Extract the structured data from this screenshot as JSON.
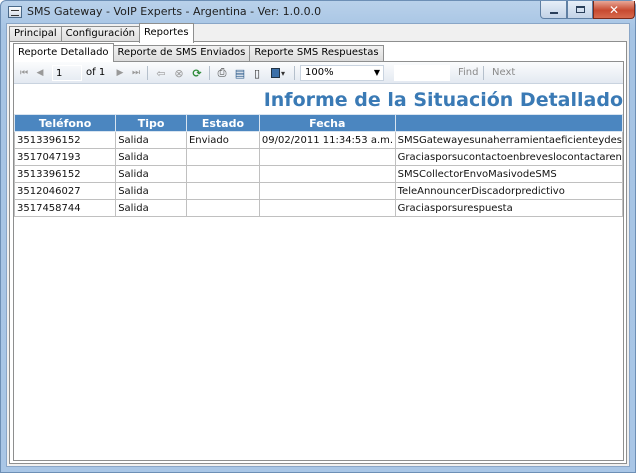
{
  "window": {
    "title": "SMS Gateway - VoIP Experts - Argentina - Ver:  1.0.0.0",
    "close_glyph": "✕"
  },
  "main_tabs": [
    {
      "label": "Principal"
    },
    {
      "label": "Configuración"
    },
    {
      "label": "Reportes"
    }
  ],
  "report_tabs": [
    {
      "label": "Reporte Detallado"
    },
    {
      "label": "Reporte de SMS Enviados"
    },
    {
      "label": "Reporte SMS Respuestas"
    }
  ],
  "toolbar": {
    "first_glyph": "⏮",
    "prev_glyph": "◀",
    "page_value": "1",
    "of_label": "of 1",
    "next_glyph": "▶",
    "last_glyph": "⏭",
    "back_glyph": "⇦",
    "stop_glyph": "⊗",
    "refresh_glyph": "⟳",
    "print_glyph": "⎙",
    "layout_glyph": "▤",
    "pagesetup_glyph": "▯",
    "export_glyph": "▾",
    "zoom_value": "100%",
    "zoom_arrow": "▼",
    "find_label": "Find",
    "next_label": "Next"
  },
  "report": {
    "title": "Informe de la Situación Detallado",
    "columns": [
      "Teléfono",
      "Tipo",
      "Estado",
      "Fecha",
      ""
    ],
    "rows": [
      [
        "3513396152",
        "Salida",
        "Enviado",
        "09/02/2011 11:34:53 a.m.",
        "SMSGatewayesunaherramientaeficienteydes"
      ],
      [
        "3517047193",
        "Salida",
        "",
        "",
        "Graciasporsucontactoenbreveslocontactaren"
      ],
      [
        "3513396152",
        "Salida",
        "",
        "",
        "SMSCollectorEnvoMasivodeSMS"
      ],
      [
        "3512046027",
        "Salida",
        "",
        "",
        "TeleAnnouncerDiscadorpredictivo"
      ],
      [
        "3517458744",
        "Salida",
        "",
        "",
        "Graciasporsurespuesta"
      ]
    ]
  },
  "colors": {
    "header_bg": "#4b86c0",
    "title_color": "#3a7ab5",
    "close_button": "#c74a30"
  }
}
